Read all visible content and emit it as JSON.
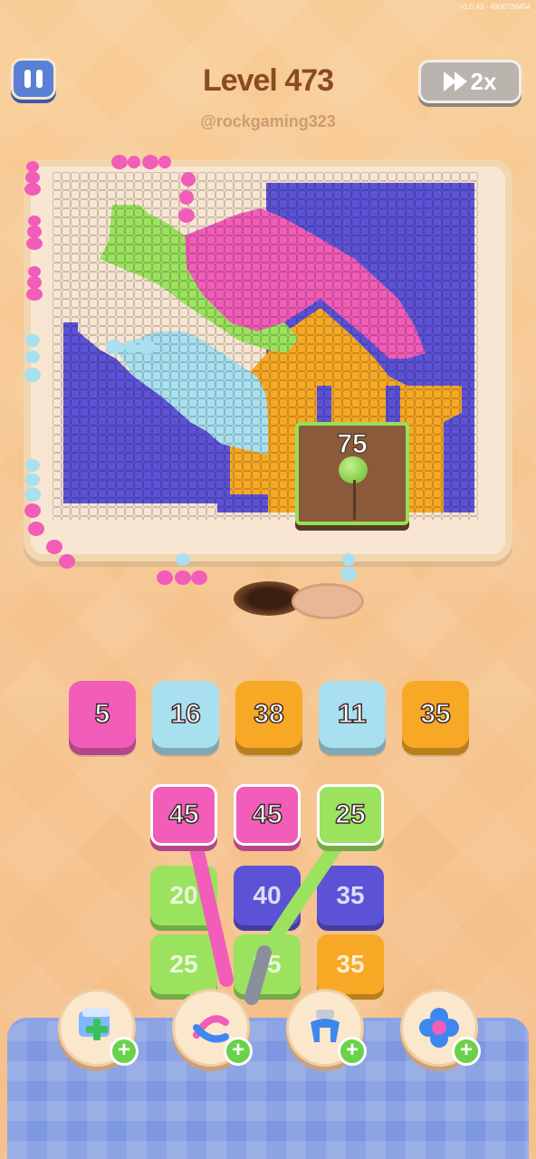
{
  "version": "v1.0.43 - 4906736454",
  "header": {
    "level_label": "Level 473",
    "handle": "@rockgaming323",
    "speed_label": "2x"
  },
  "door": {
    "count": "75"
  },
  "queue": [
    {
      "value": "5",
      "color": "#f15db8"
    },
    {
      "value": "16",
      "color": "#a8e0f0"
    },
    {
      "value": "38",
      "color": "#f7a925"
    },
    {
      "value": "11",
      "color": "#a8e0f0"
    },
    {
      "value": "35",
      "color": "#f7a925"
    }
  ],
  "grid": {
    "row1": [
      {
        "value": "45",
        "color": "#f15db8"
      },
      {
        "value": "45",
        "color": "#f15db8"
      },
      {
        "value": "25",
        "color": "#9be25e"
      }
    ],
    "row2": [
      {
        "value": "20",
        "color": "#9be25e"
      },
      {
        "value": "40",
        "color": "#5c52d6"
      },
      {
        "value": "35",
        "color": "#5c52d6"
      }
    ],
    "row3": [
      {
        "value": "25",
        "color": "#9be25e"
      },
      {
        "value": "25",
        "color": "#9be25e"
      },
      {
        "value": "35",
        "color": "#f7a925"
      }
    ]
  },
  "powerups": [
    {
      "icon": "add-box-icon"
    },
    {
      "icon": "swap-arrows-icon"
    },
    {
      "icon": "magnet-claw-icon"
    },
    {
      "icon": "flower-gear-icon"
    }
  ],
  "colors": {
    "pink": "#f15db8",
    "light_blue": "#a8e0f0",
    "orange": "#f7a925",
    "green": "#9be25e",
    "purple": "#5c52d6"
  }
}
